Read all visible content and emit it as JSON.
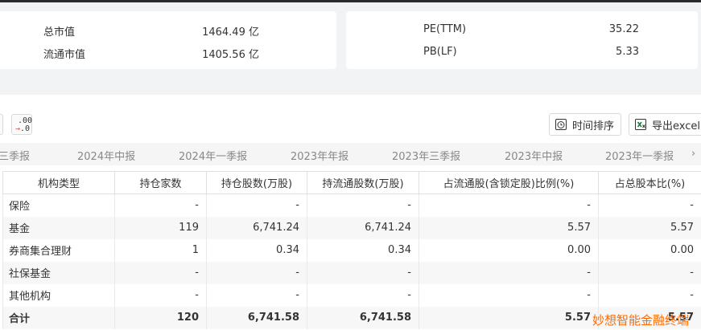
{
  "summary_left": {
    "rows": [
      {
        "label": "总市值",
        "value": "1464.49 亿"
      },
      {
        "label": "流通市值",
        "value": "1405.56 亿"
      }
    ]
  },
  "summary_right": {
    "rows": [
      {
        "label": "PE(TTM)",
        "value": "35.22"
      },
      {
        "label": "PB(LF)",
        "value": "5.33"
      }
    ]
  },
  "toolbar": {
    "decimal_icon_top": ".00",
    "decimal_icon_bottom": ".0",
    "sort_label": "时间排序",
    "export_label": "导出excel",
    "sort_icon": "clock-icon",
    "export_icon": "excel-icon"
  },
  "tabs": [
    "三季报",
    "2024年中报",
    "2024年一季报",
    "2023年年报",
    "2023年三季报",
    "2023年中报",
    "2023年一季报"
  ],
  "tabs_next": "›",
  "table": {
    "headers": [
      "机构类型",
      "持仓家数",
      "持仓股数(万股)",
      "持流通股数(万股)",
      "占流通股(含锁定股)比例(%)",
      "占总股本比(%)"
    ],
    "rows": [
      [
        "保险",
        "-",
        "-",
        "-",
        "-",
        "-"
      ],
      [
        "基金",
        "119",
        "6,741.24",
        "6,741.24",
        "5.57",
        "5.57"
      ],
      [
        "券商集合理财",
        "1",
        "0.34",
        "0.34",
        "0.00",
        "0.00"
      ],
      [
        "社保基金",
        "-",
        "-",
        "-",
        "-",
        "-"
      ],
      [
        "其他机构",
        "-",
        "-",
        "-",
        "-",
        "-"
      ],
      [
        "合计",
        "120",
        "6,741.58",
        "6,741.58",
        "5.57",
        "5.57"
      ]
    ]
  },
  "watermark": "妙想智能金融终端",
  "colors": {
    "accent": "#ff6a00",
    "page_bg": "#f2f3f5"
  }
}
